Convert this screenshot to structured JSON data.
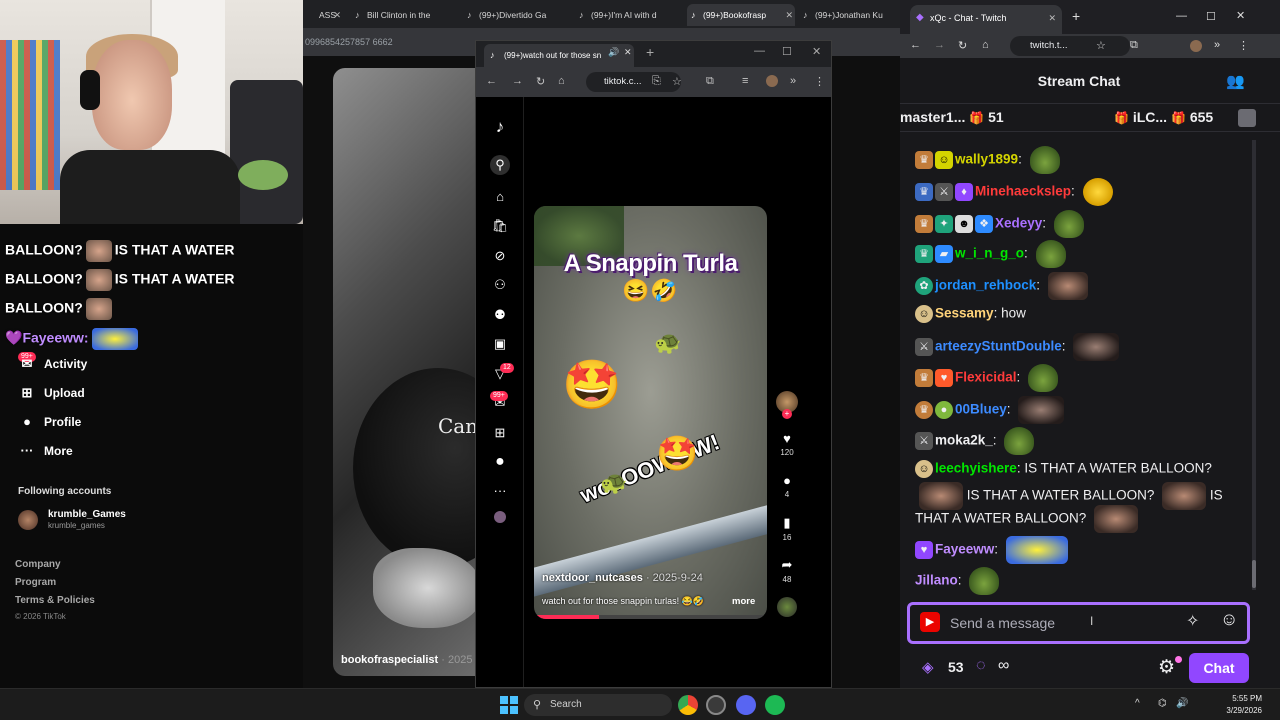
{
  "background_browser": {
    "tabs": [
      {
        "label": "ASS"
      },
      {
        "label": "Bill Clinton in the"
      },
      {
        "label": "(99+)Divertido Ga"
      },
      {
        "label": "(99+)I'm AI with d"
      },
      {
        "label": "(99+)Bookofrasp"
      },
      {
        "label": "(99+)Jonathan Ku"
      }
    ],
    "url_fragment": "0996854257857 6662",
    "video_text": "Can",
    "author": "bookofraspecialist",
    "author_date": "· 2025"
  },
  "tiktok_sidebar": {
    "chat_echo": [
      {
        "prefix": "BALLOON?",
        "suffix": "IS THAT A WATER"
      },
      {
        "prefix": "BALLOON?",
        "suffix": "IS THAT A WATER"
      },
      {
        "prefix": "BALLOON?",
        "suffix": ""
      }
    ],
    "echo_user": "Fayeeww:",
    "items": [
      {
        "label": "Activity",
        "icon": "activity-icon",
        "glyph": "✉",
        "badge": "99+"
      },
      {
        "label": "Upload",
        "icon": "upload-icon",
        "glyph": "⊞"
      },
      {
        "label": "Profile",
        "icon": "profile-icon",
        "glyph": "●"
      },
      {
        "label": "More",
        "icon": "more-icon",
        "glyph": "···"
      }
    ],
    "following_title": "Following accounts",
    "following": {
      "name": "krumble_Games",
      "handle": "krumble_games"
    },
    "footer_links": [
      "Company",
      "Program",
      "Terms & Policies"
    ],
    "copyright": "© 2026 TikTok"
  },
  "popup_window": {
    "tab_label": "(99+)watch out for those sn",
    "url": "tiktok.c...",
    "rail_badges": {
      "inbox": "12",
      "messages": "99+"
    },
    "video": {
      "title": "A Snappin Turla",
      "overlay_text": "wooOOWWW!",
      "author": "nextdoor_nutcases",
      "date": "· 2025-9-24",
      "caption": "watch out for those snappin turlas! 😂🤣",
      "more": "more",
      "progress": 0.28
    },
    "actions": [
      {
        "name": "like",
        "icon": "heart-icon",
        "glyph": "♥",
        "count": "120"
      },
      {
        "name": "comment",
        "icon": "comment-icon",
        "glyph": "●",
        "count": "4"
      },
      {
        "name": "bookmark",
        "icon": "bookmark-icon",
        "glyph": "▮",
        "count": "16"
      },
      {
        "name": "share",
        "icon": "share-icon",
        "glyph": "➦",
        "count": "48"
      }
    ]
  },
  "chat_window": {
    "tab_label": "xQc - Chat - Twitch",
    "url": "twitch.t...",
    "header_title": "Stream Chat",
    "gift_bar": [
      {
        "user": "master1...",
        "count": "51"
      },
      {
        "user": "iLC...",
        "count": "655"
      }
    ],
    "messages": [
      {
        "user": "wally1899",
        "color": "#d4d400",
        "text": ""
      },
      {
        "user": "Minehaeckslер",
        "color": "#ff3b3b",
        "text": ""
      },
      {
        "user": "Xedeyy",
        "color": "#a970ff",
        "text": ""
      },
      {
        "user": "w_i_n_g_o",
        "color": "#00e600",
        "text": ""
      },
      {
        "user": "jordan_rehbock",
        "color": "#1e90ff",
        "text": ""
      },
      {
        "user": "Sessamy",
        "color": "#ffd37a",
        "text": "how"
      },
      {
        "user": "arteezyStuntDouble",
        "color": "#3d8bff",
        "text": ""
      },
      {
        "user": "Flexicidal",
        "color": "#ff3b3b",
        "text": ""
      },
      {
        "user": "00Bluey",
        "color": "#3d8bff",
        "text": ""
      },
      {
        "user": "moka2k_",
        "color": "#efeff1",
        "text": ""
      },
      {
        "user": "leechyishere",
        "color": "#00e600",
        "text": "IS THAT A WATER BALLOON?"
      },
      {
        "user": "Fayeeww",
        "color": "#c08dff",
        "text": ""
      },
      {
        "user": "Jillano",
        "color": "#c08dff",
        "text": ""
      }
    ],
    "leechy_line2": "IS THAT A WATER BALLOON?",
    "leechy_line2b": "IS",
    "leechy_line3": "THAT A WATER BALLOON?",
    "input_placeholder": "Send a message",
    "channel_points": "53",
    "prime_symbol": "∞",
    "send_label": "Chat",
    "colors": {
      "accent": "#9147ff",
      "focus": "#a970ff"
    }
  },
  "taskbar": {
    "search_label": "Search",
    "time": "5:55 PM",
    "date": "3/29/2026",
    "tray": "^"
  }
}
